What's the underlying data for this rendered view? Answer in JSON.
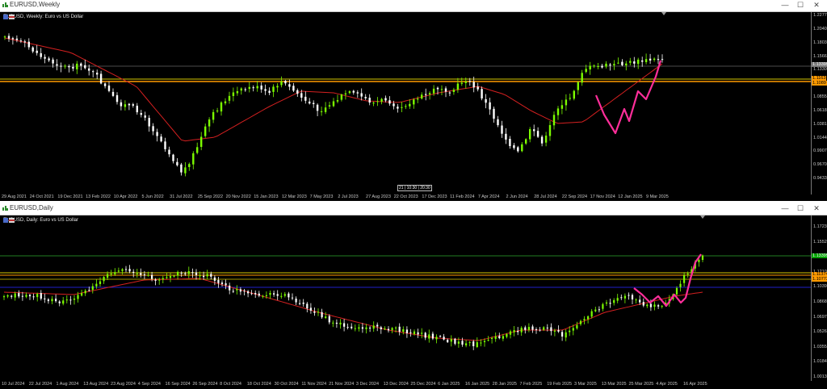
{
  "windows": [
    {
      "title": "EURUSD,Weekly",
      "symbol": "EURUSD, Weekly:  Euro vs US Dollar",
      "controls": {
        "minimize": "—",
        "maximize": "☐",
        "close": "✕"
      },
      "price_labels": [
        "1.2277",
        "1.2040",
        "1.1803",
        "1.1566",
        "1.1330",
        "1.1093",
        "1.0855",
        "1.0618",
        "1.0381",
        "1.0144",
        "0.9907",
        "0.9670",
        "0.9433"
      ],
      "current_tag": "1.13399",
      "orange_tags": [
        "1.1163",
        "1.1089"
      ],
      "time_tip": [
        "21",
        "10:30",
        "20:30"
      ],
      "date_labels": [
        "29 Aug 2021",
        "24 Oct 2021",
        "19 Dec 2021",
        "13 Feb 2022",
        "10 Apr 2022",
        "5 Jun 2022",
        "31 Jul 2022",
        "25 Sep 2022",
        "20 Nov 2022",
        "15 Jan 2023",
        "12 Mar 2023",
        "7 May 2023",
        "2 Jul 2023",
        "27 Aug 2023",
        "22 Oct 2023",
        "17 Dec 2023",
        "11 Feb 2024",
        "7 Apr 2024",
        "2 Jun 2024",
        "28 Jul 2024",
        "22 Sep 2024",
        "17 Nov 2024",
        "12 Jan 2025",
        "9 Mar 2025"
      ]
    },
    {
      "title": "EURUSD,Daily",
      "symbol": "EURUSD, Daily:  Euro vs US Dollar",
      "controls": {
        "minimize": "—",
        "maximize": "☐",
        "close": "✕"
      },
      "price_labels": [
        "1.17230",
        "1.15520",
        "1.13810",
        "1.12100",
        "1.10390",
        "1.08680",
        "1.06970",
        "1.05260",
        "1.03550",
        "1.01840",
        "1.00130"
      ],
      "current_tag": "1.13399",
      "orange_tags": [
        "1.11374",
        "1.10773"
      ],
      "date_labels": [
        "10 Jul 2024",
        "22 Jul 2024",
        "1 Aug 2024",
        "13 Aug 2024",
        "23 Aug 2024",
        "4 Sep 2024",
        "16 Sep 2024",
        "26 Sep 2024",
        "8 Oct 2024",
        "18 Oct 2024",
        "30 Oct 2024",
        "11 Nov 2024",
        "21 Nov 2024",
        "3 Dec 2024",
        "13 Dec 2024",
        "25 Dec 2024",
        "6 Jan 2025",
        "16 Jan 2025",
        "28 Jan 2025",
        "7 Feb 2025",
        "19 Feb 2025",
        "3 Mar 2025",
        "13 Mar 2025",
        "25 Mar 2025",
        "4 Apr 2025",
        "16 Apr 2025"
      ]
    }
  ],
  "colors": {
    "background": "#000000",
    "bull": "#7CFC00",
    "bear": "#ffffff",
    "ma": "#d42020",
    "orange": "#ff9a00",
    "yellow": "#e8e800",
    "pink": "#ff2e9a",
    "blue": "#2020c8",
    "current": "#00a000"
  }
}
